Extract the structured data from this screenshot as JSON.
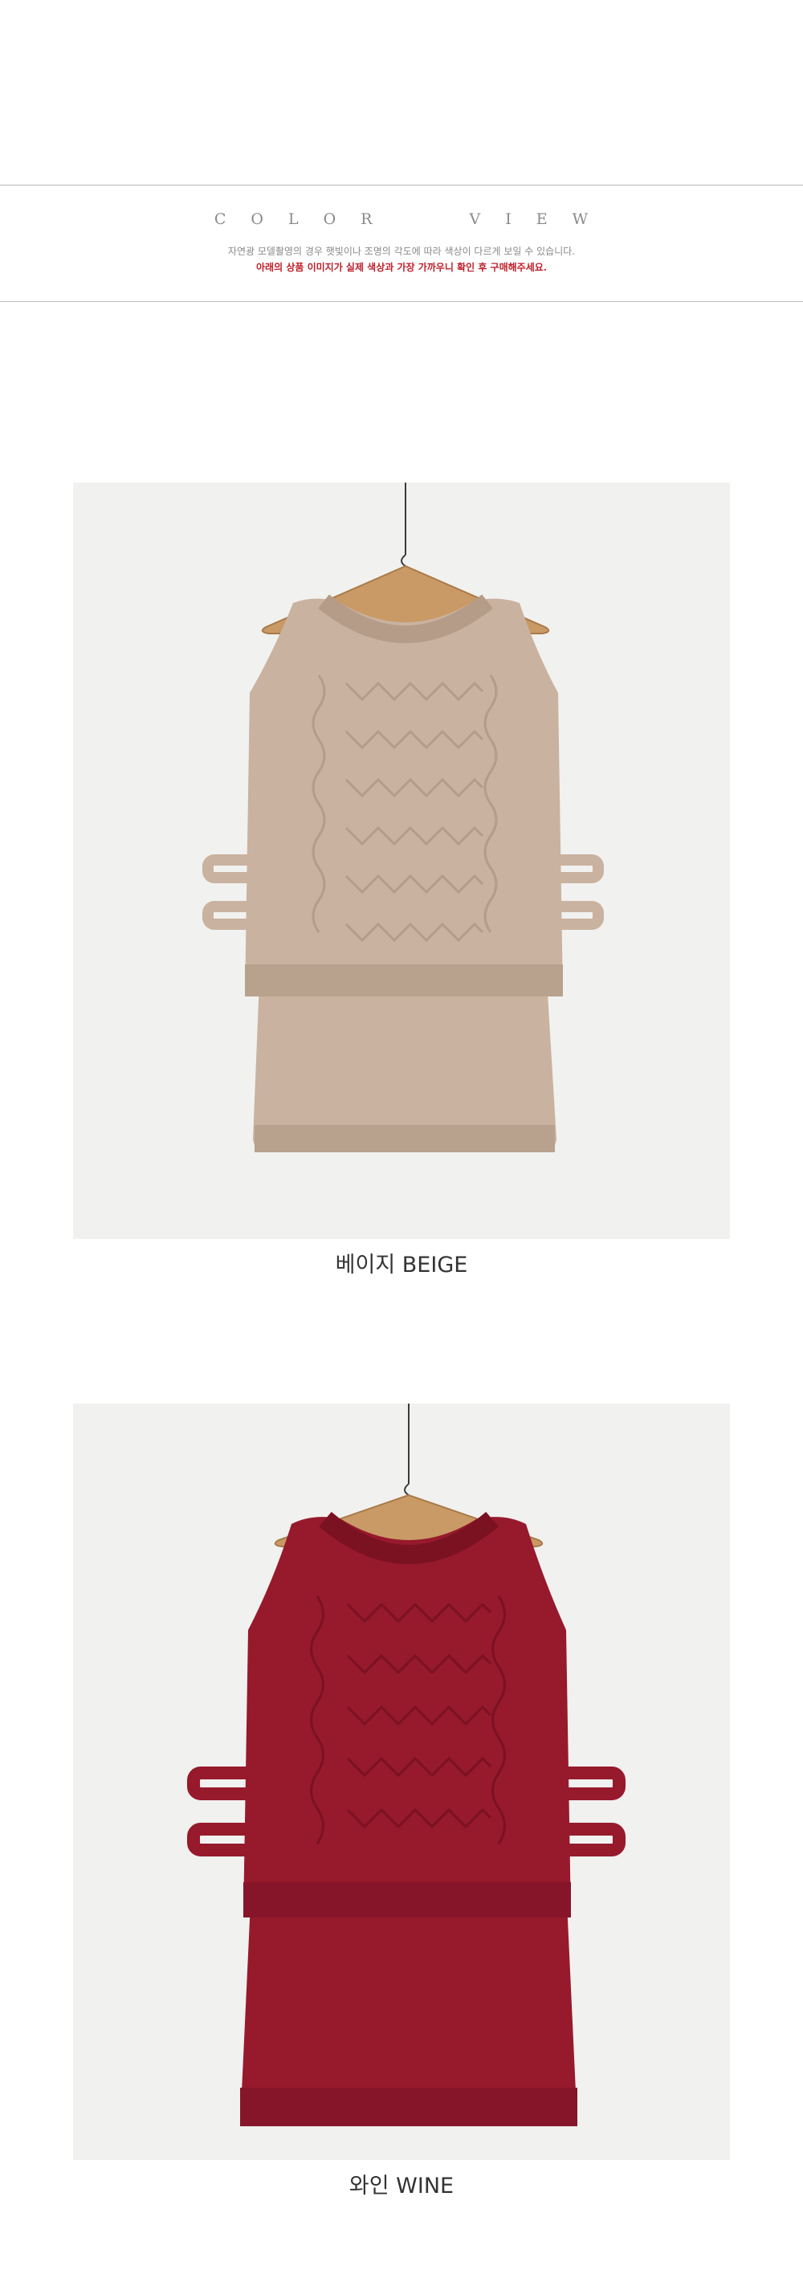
{
  "color_view": {
    "title_letters_1": [
      "C",
      "O",
      "L",
      "O",
      "R"
    ],
    "title_letters_2": [
      "V",
      "I",
      "E",
      "W"
    ],
    "note_primary": "자연광 모델촬영의 경우 햇빛이나 조명의 각도에 따라 색상이 다르게 보일 수 있습니다.",
    "note_warning": "아래의 상품 이미지가 실제 색상과 가장 가까우니 확인 후 구매해주세요."
  },
  "products": [
    {
      "caption": "베이지 BEIGE",
      "color": "#c9b29f",
      "shade": "#b49c88",
      "light": "#d8c5b4"
    },
    {
      "caption": "와인 WINE",
      "color": "#97192c",
      "shade": "#7a1222",
      "light": "#a82538"
    }
  ],
  "hanger_color": "#c99a66"
}
